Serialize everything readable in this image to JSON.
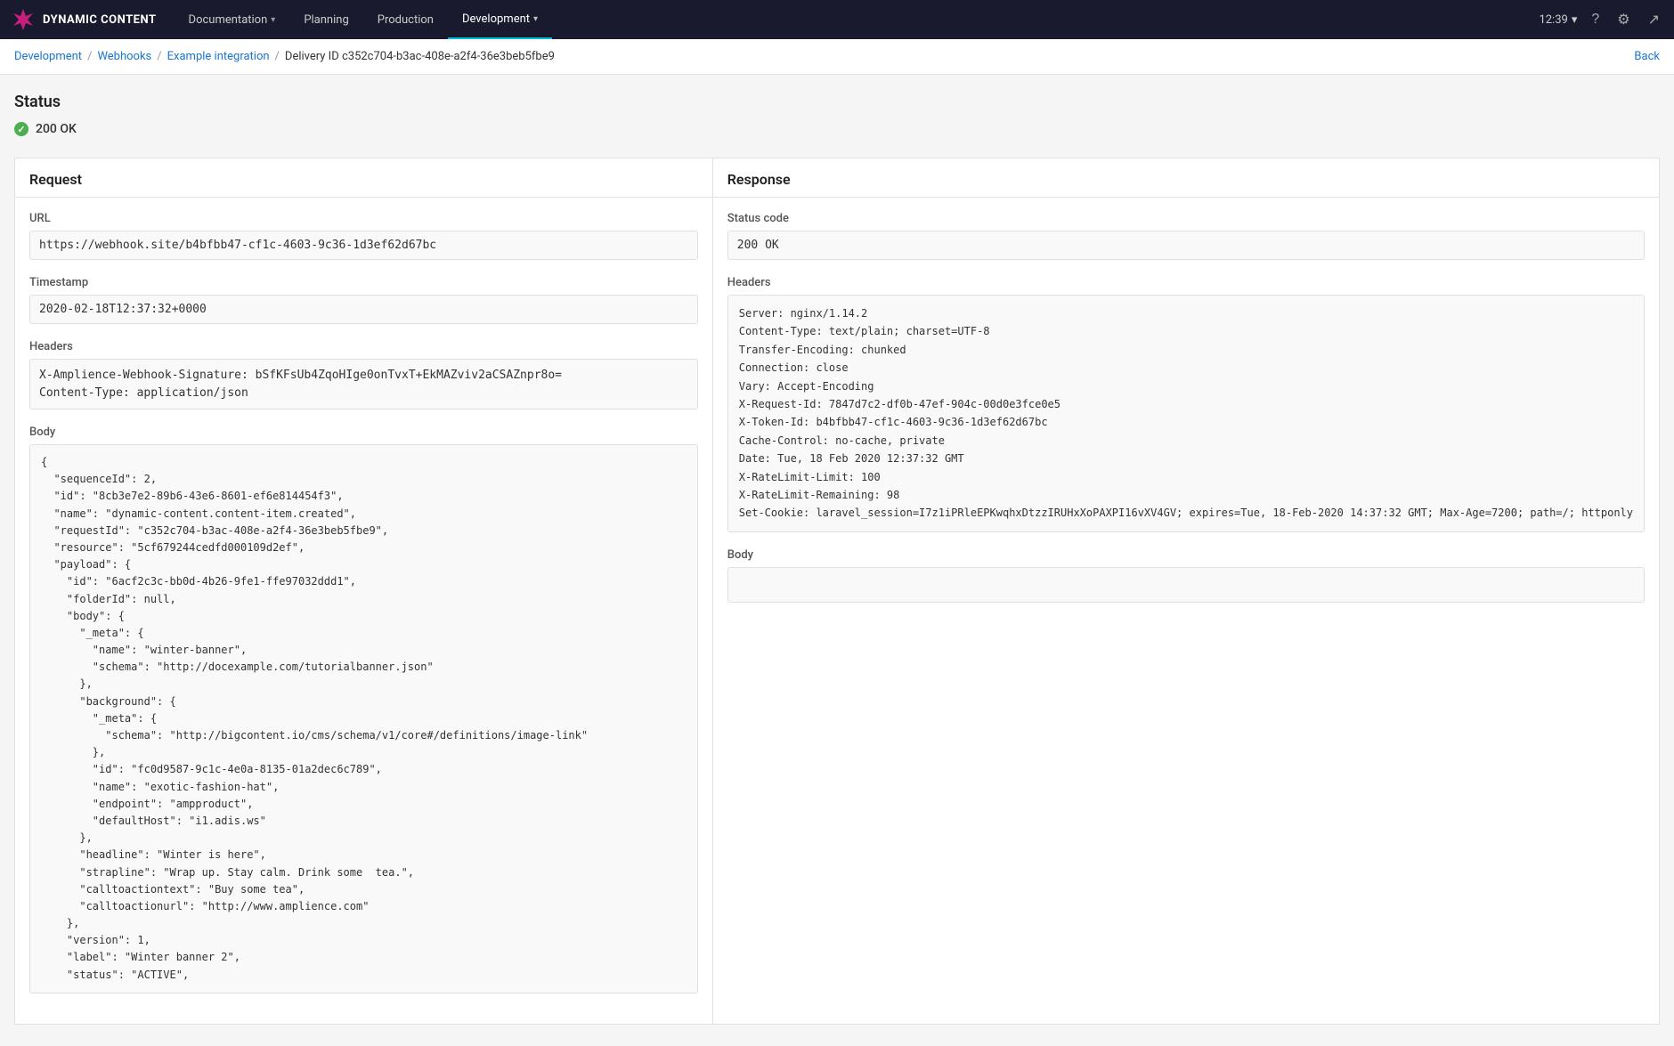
{
  "nav": {
    "logo_text": "DYNAMIC CONTENT",
    "items": [
      {
        "label": "Documentation",
        "has_dropdown": true,
        "active": false
      },
      {
        "label": "Planning",
        "has_dropdown": false,
        "active": false
      },
      {
        "label": "Production",
        "has_dropdown": false,
        "active": false
      },
      {
        "label": "Development",
        "has_dropdown": true,
        "active": true
      }
    ],
    "time": "12:39",
    "time_chevron": "▾"
  },
  "breadcrumb": {
    "items": [
      {
        "label": "Development",
        "link": true
      },
      {
        "label": "Webhooks",
        "link": true
      },
      {
        "label": "Example integration",
        "link": true
      },
      {
        "label": "Delivery ID c352c704-b3ac-408e-a2f4-36e3beb5fbe9",
        "link": false
      }
    ],
    "back_label": "Back"
  },
  "status": {
    "title": "Status",
    "value": "200 OK"
  },
  "request": {
    "panel_title": "Request",
    "url_label": "URL",
    "url_value": "https://webhook.site/b4bfbb47-cf1c-4603-9c36-1d3ef62d67bc",
    "timestamp_label": "Timestamp",
    "timestamp_value": "2020-02-18T12:37:32+0000",
    "headers_label": "Headers",
    "headers_value": "X-Amplience-Webhook-Signature: bSfKFsUb4ZqoHIge0onTvxT+EkMAZviv2aCSAZnpr8o=\nContent-Type: application/json",
    "body_label": "Body",
    "body_value": "{\n  \"sequenceId\": 2,\n  \"id\": \"8cb3e7e2-89b6-43e6-8601-ef6e814454f3\",\n  \"name\": \"dynamic-content.content-item.created\",\n  \"requestId\": \"c352c704-b3ac-408e-a2f4-36e3beb5fbe9\",\n  \"resource\": \"5cf679244cedfd000109d2ef\",\n  \"payload\": {\n    \"id\": \"6acf2c3c-bb0d-4b26-9fe1-ffe97032ddd1\",\n    \"folderId\": null,\n    \"body\": {\n      \"_meta\": {\n        \"name\": \"winter-banner\",\n        \"schema\": \"http://docexample.com/tutorialbanner.json\"\n      },\n      \"background\": {\n        \"_meta\": {\n          \"schema\": \"http://bigcontent.io/cms/schema/v1/core#/definitions/image-link\"\n        },\n        \"id\": \"fc0d9587-9c1c-4e0a-8135-01a2dec6c789\",\n        \"name\": \"exotic-fashion-hat\",\n        \"endpoint\": \"ampproduct\",\n        \"defaultHost\": \"i1.adis.ws\"\n      },\n      \"headline\": \"Winter is here\",\n      \"strapline\": \"Wrap up. Stay calm. Drink some  tea.\",\n      \"calltoactiontext\": \"Buy some tea\",\n      \"calltoactionurl\": \"http://www.amplience.com\"\n    },\n    \"version\": 1,\n    \"label\": \"Winter banner 2\",\n    \"status\": \"ACTIVE\","
  },
  "response": {
    "panel_title": "Response",
    "status_code_label": "Status code",
    "status_code_value": "200 OK",
    "headers_label": "Headers",
    "headers_value": "Server: nginx/1.14.2\nContent-Type: text/plain; charset=UTF-8\nTransfer-Encoding: chunked\nConnection: close\nVary: Accept-Encoding\nX-Request-Id: 7847d7c2-df0b-47ef-904c-00d0e3fce0e5\nX-Token-Id: b4bfbb47-cf1c-4603-9c36-1d3ef62d67bc\nCache-Control: no-cache, private\nDate: Tue, 18 Feb 2020 12:37:32 GMT\nX-RateLimit-Limit: 100\nX-RateLimit-Remaining: 98\nSet-Cookie: laravel_session=I7z1iPRleEPKwqhxDtzzIRUHxXoPAXPI16vXV4GV; expires=Tue, 18-Feb-2020 14:37:32 GMT; Max-Age=7200; path=/; httponly",
    "body_label": "Body",
    "body_value": ""
  }
}
